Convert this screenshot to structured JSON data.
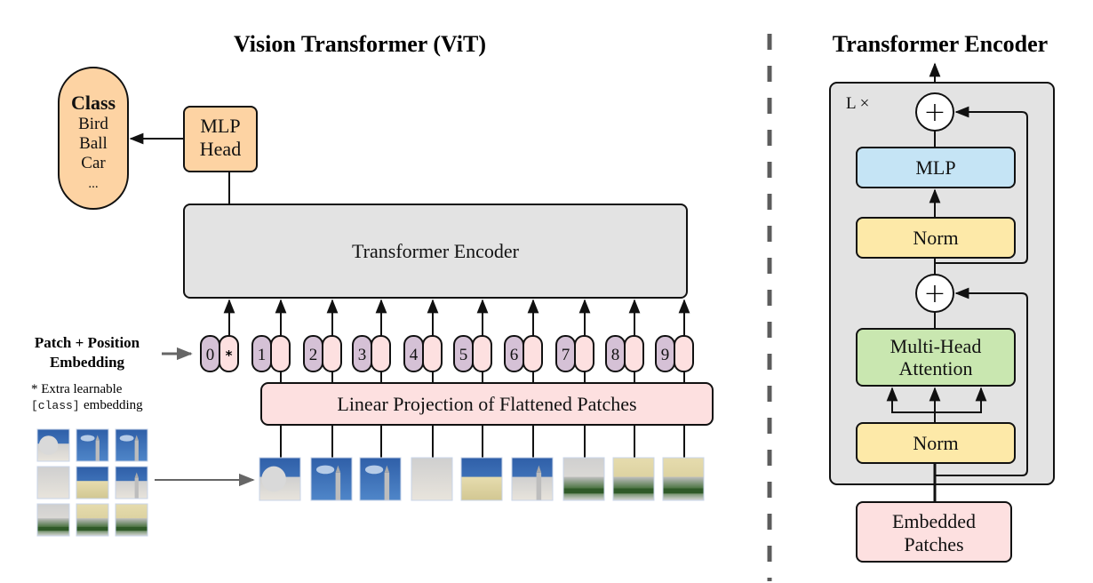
{
  "left_panel": {
    "title": "Vision Transformer (ViT)",
    "class_box": {
      "heading": "Class",
      "items": [
        "Bird",
        "Ball",
        "Car",
        "..."
      ]
    },
    "mlp_head": {
      "line1": "MLP",
      "line2": "Head"
    },
    "transformer_encoder": "Transformer Encoder",
    "embedding_label": {
      "line1": "Patch + Position",
      "line2": "Embedding"
    },
    "footnote": {
      "line1": "* Extra learnable",
      "line2_mono": "[class]",
      "line2_rest": " embedding"
    },
    "linear_projection": "Linear Projection of Flattened Patches",
    "tokens": [
      {
        "position": "0",
        "extra": "*"
      },
      {
        "position": "1",
        "extra": ""
      },
      {
        "position": "2",
        "extra": ""
      },
      {
        "position": "3",
        "extra": ""
      },
      {
        "position": "4",
        "extra": ""
      },
      {
        "position": "5",
        "extra": ""
      },
      {
        "position": "6",
        "extra": ""
      },
      {
        "position": "7",
        "extra": ""
      },
      {
        "position": "8",
        "extra": ""
      },
      {
        "position": "9",
        "extra": ""
      }
    ],
    "patch_count": 9,
    "image_grid": "3x3"
  },
  "right_panel": {
    "title": "Transformer Encoder",
    "repeat_label": "L ×",
    "blocks": {
      "mlp": "MLP",
      "norm_top": "Norm",
      "attention": {
        "line1": "Multi-Head",
        "line2": "Attention"
      },
      "norm_bottom": "Norm",
      "embedded": {
        "line1": "Embedded",
        "line2": "Patches"
      }
    },
    "add_symbol": "+"
  },
  "colors": {
    "orange": "#fdd3a3",
    "encoder_gray": "#e3e3e3",
    "pink": "#fde0e0",
    "purple": "#d5c1d6",
    "blue": "#c5e4f5",
    "yellow": "#fde9a8",
    "green": "#c9e7b0",
    "divider": "#5c5c5c"
  }
}
